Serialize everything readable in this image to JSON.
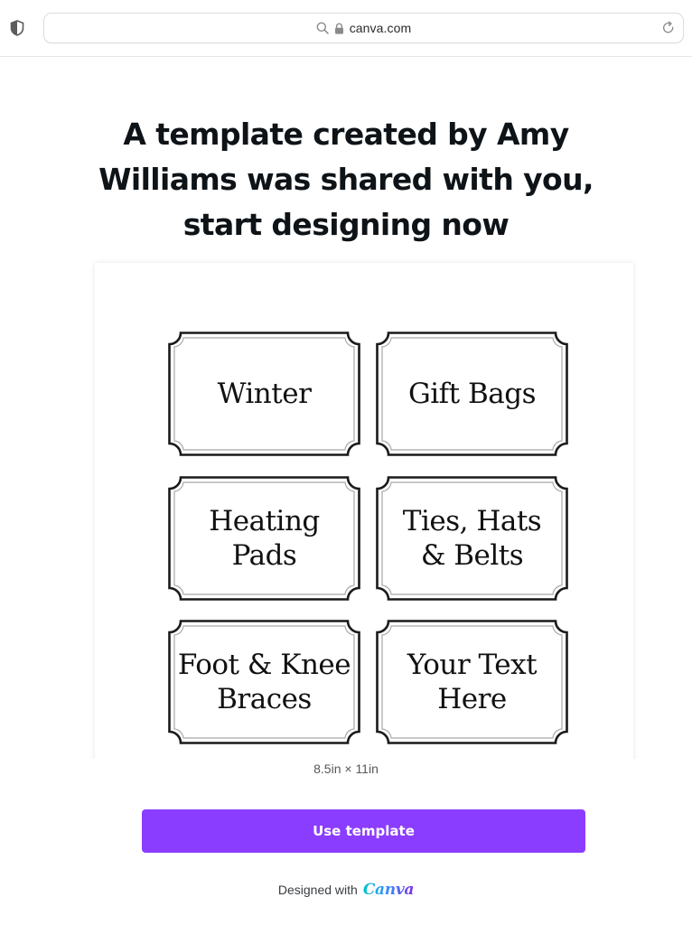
{
  "browser": {
    "url": "canva.com",
    "icons": {
      "privacy": "shield-icon",
      "search": "search-icon",
      "secure": "lock-icon",
      "reload": "reload-icon"
    }
  },
  "headline": {
    "lines": [
      "A template created by Amy",
      "Williams was shared with you,",
      "start designing now"
    ]
  },
  "preview": {
    "labels": [
      {
        "lines": [
          "Winter"
        ]
      },
      {
        "lines": [
          "Gift Bags"
        ]
      },
      {
        "lines": [
          "Heating",
          "Pads"
        ]
      },
      {
        "lines": [
          "Ties, Hats",
          "& Belts"
        ]
      },
      {
        "lines": [
          "Foot & Knee",
          "Braces"
        ]
      },
      {
        "lines": [
          "Your Text",
          "Here"
        ]
      }
    ]
  },
  "dimensions": "8.5in × 11in",
  "cta": {
    "label": "Use template",
    "color": "#8b3dff"
  },
  "footer": {
    "text": "Designed with",
    "brand": "Canva"
  }
}
